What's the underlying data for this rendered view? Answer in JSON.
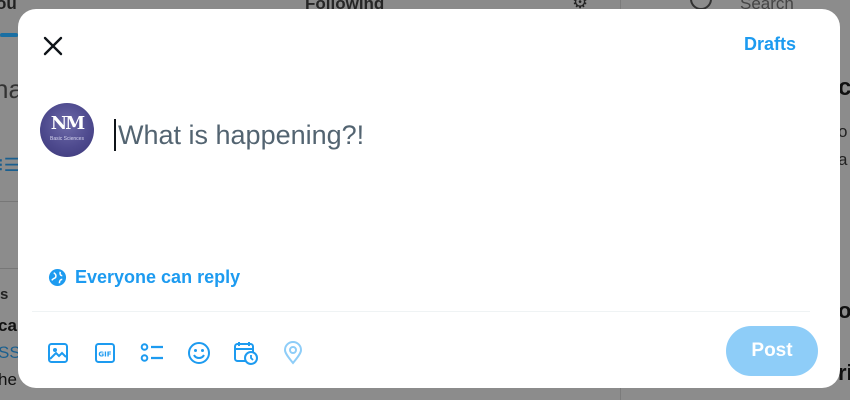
{
  "background": {
    "tab_you": "ou",
    "tab_following": "Following",
    "search_placeholder": "Search",
    "left_fragment_heading": "ha",
    "left_fragment_s": "s",
    "left_fragment_ca": "ca",
    "left_fragment_ss": "SS",
    "left_fragment_he": "he",
    "right_fragment_c": "c",
    "right_fragment_o": "o",
    "right_fragment_a": "a",
    "right_fragment_r1": "o",
    "right_fragment_r2": "ri"
  },
  "modal": {
    "drafts_label": "Drafts",
    "composer_placeholder": "What is happening?!",
    "reply_setting": "Everyone can reply",
    "post_label": "Post",
    "avatar_logo": "NM",
    "avatar_subtitle": "Basic Sciences"
  },
  "toolbar": {
    "icons": [
      "image-icon",
      "gif-icon",
      "poll-icon",
      "emoji-icon",
      "schedule-icon",
      "location-icon"
    ]
  },
  "colors": {
    "accent": "#1d9bf0",
    "post_disabled": "#8ecdf8",
    "placeholder": "#536471",
    "overlay": "#8c8c8c"
  }
}
